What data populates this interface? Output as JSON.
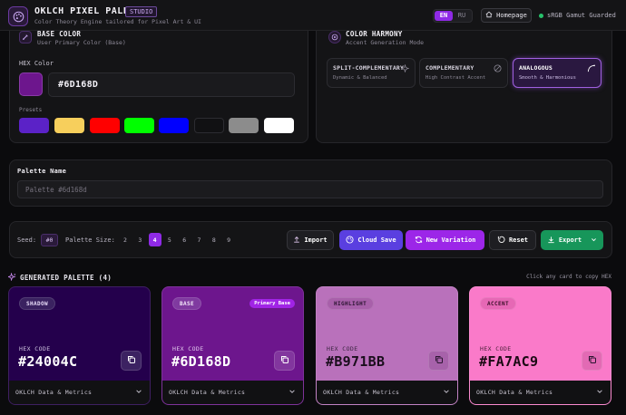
{
  "header": {
    "title": "OKLCH PIXEL PALETTE",
    "badge": "STUDIO",
    "subtitle": "Color Theory Engine tailored for Pixel Art & UI",
    "languages": [
      "EN",
      "RU"
    ],
    "active_language": "EN",
    "homepage_label": "Homepage",
    "gamut_status": "sRGB Gamut Guarded",
    "gamut_color": "#27c26b"
  },
  "base_color": {
    "title": "BASE COLOR",
    "subtitle": "User Primary Color (Base)",
    "hex_label": "HEX Color",
    "hex_value": "#6D168D",
    "swatch_color": "#6d168d",
    "presets_label": "Presets",
    "presets": [
      "#5b22c7",
      "#f7cf5c",
      "#ff0000",
      "#00ff00",
      "#0000ff",
      "#111113",
      "#8c8c8c",
      "#ffffff"
    ]
  },
  "harmony": {
    "title": "COLOR HARMONY",
    "subtitle": "Accent Generation Mode",
    "options": [
      {
        "title": "SPLIT-COMPLEMENTARY",
        "subtitle": "Dynamic & Balanced",
        "icon": "sparkle-icon",
        "active": false
      },
      {
        "title": "COMPLEMENTARY",
        "subtitle": "High Contrast Accent",
        "icon": "contrast-icon",
        "active": false
      },
      {
        "title": "ANALOGOUS",
        "subtitle": "Smooth & Harmonious",
        "icon": "arc-icon",
        "active": true
      }
    ]
  },
  "palette_name": {
    "label": "Palette Name",
    "placeholder": "Palette #6d168d"
  },
  "toolbar": {
    "seed_label": "Seed:",
    "seed_value": "#0",
    "size_label": "Palette Size:",
    "sizes": [
      "2",
      "3",
      "4",
      "5",
      "6",
      "7",
      "8",
      "9"
    ],
    "active_size": "4",
    "import_label": "Import",
    "cloud_label": "Cloud Save",
    "variation_label": "New Variation",
    "reset_label": "Reset",
    "export_label": "Export"
  },
  "generated": {
    "title": "GENERATED PALETTE (4)",
    "hint": "Click any card to copy HEX",
    "hex_code_label": "HEX CODE",
    "footer_label": "OKLCH Data & Metrics",
    "primary_badge": "Primary Base",
    "cards": [
      {
        "role": "SHADOW",
        "hex": "#24004C",
        "bg": "#24004c",
        "text": "#ffffff",
        "muted": "#cfc4e0",
        "badge_bg": "#3a2260",
        "badge_text": "#e8dcf8",
        "btn_bg": "#3c2262",
        "dark_text": false,
        "primary": false
      },
      {
        "role": "BASE",
        "hex": "#6D168D",
        "bg": "#6d168d",
        "text": "#ffffff",
        "muted": "#e0c8ec",
        "badge_bg": "#803aa0",
        "badge_text": "#f4e8fa",
        "btn_bg": "#82369e",
        "dark_text": false,
        "primary": true
      },
      {
        "role": "HIGHLIGHT",
        "hex": "#B971BB",
        "bg": "#b971bb",
        "text": "#1a0e1c",
        "muted": "#3a2540",
        "badge_bg": "#a860aa",
        "badge_text": "#2a1430",
        "btn_bg": "#a762aa",
        "dark_text": true,
        "primary": false
      },
      {
        "role": "ACCENT",
        "hex": "#FA7AC9",
        "bg": "#fa7ac9",
        "text": "#1c0a14",
        "muted": "#4a2038",
        "badge_bg": "#e668b5",
        "badge_text": "#3a1028",
        "btn_bg": "#e26ab4",
        "dark_text": true,
        "primary": false
      }
    ]
  }
}
